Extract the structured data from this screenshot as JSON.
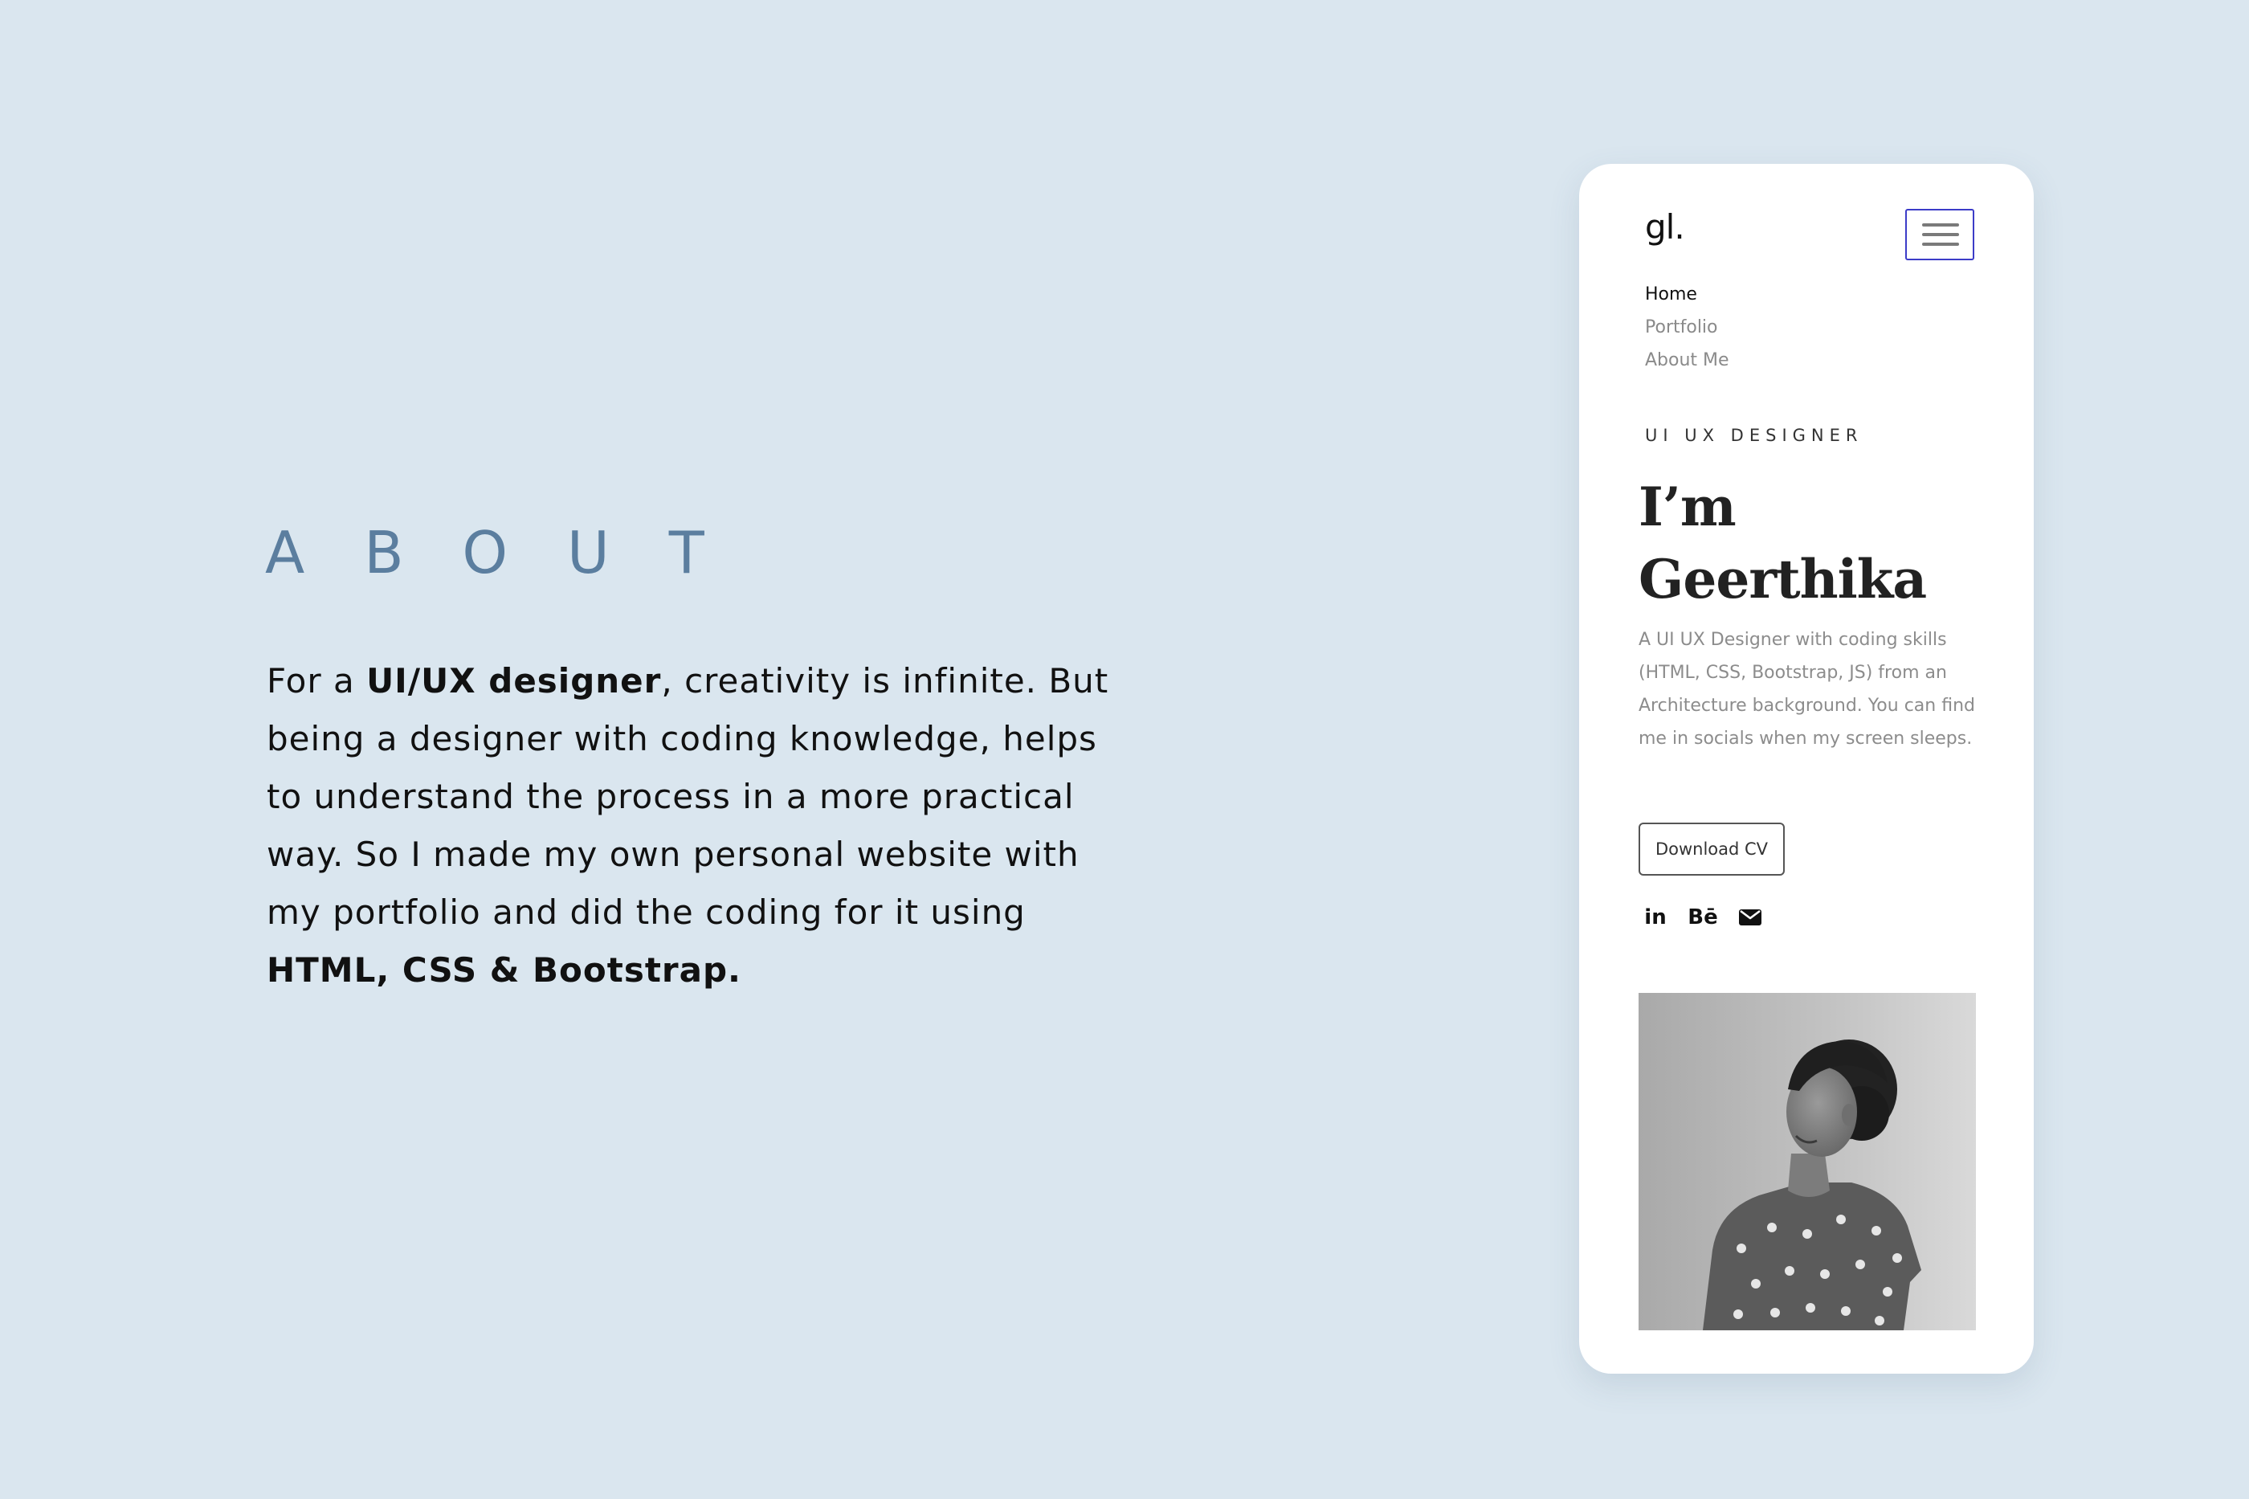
{
  "about": {
    "heading": "ABOUT",
    "body": {
      "t1": "For a ",
      "b1": "UI/UX designer",
      "t2": ", creativity is infinite. But being a designer with coding knowledge, helps to understand the process in a more practical way. So I made my own personal website with my portfolio and did the coding for it using ",
      "b2": "HTML, CSS & Bootstrap."
    }
  },
  "phone": {
    "logo": "gl.",
    "menu_icon": "hamburger-menu-icon",
    "nav": [
      {
        "label": "Home",
        "active": true
      },
      {
        "label": "Portfolio",
        "active": false
      },
      {
        "label": "About Me",
        "active": false
      }
    ],
    "role": "UI UX DESIGNER",
    "name_line1": "I’m",
    "name_line2": "Geerthika",
    "intro": "A UI UX Designer with coding skills (HTML, CSS, Bootstrap, JS) from an Architecture background. You can find me in socials when my screen sleeps.",
    "cv_button": "Download CV",
    "socials": {
      "linkedin": "in",
      "behance": "Bē",
      "mail_icon": "mail-icon"
    },
    "photo": "portrait-photo"
  },
  "colors": {
    "background": "#dae6ef",
    "about_heading": "#5b7e9f",
    "menu_border": "#3c3cc8",
    "card": "#ffffff"
  }
}
